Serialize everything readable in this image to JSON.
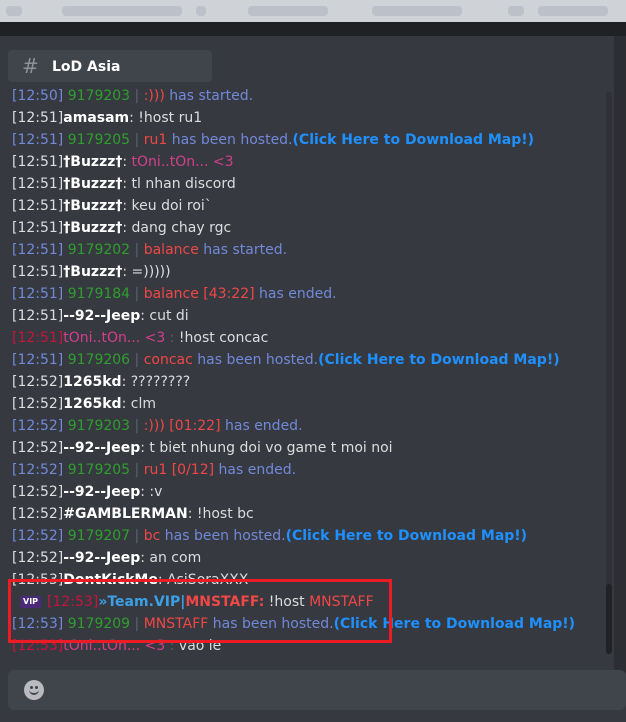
{
  "channel": {
    "name": "LoD Asia"
  },
  "messages": [
    {
      "parts": [
        {
          "text": "[12:50] ",
          "cls": "tp"
        },
        {
          "text": "9179203",
          "cls": "g"
        },
        {
          "text": " | ",
          "cls": "s"
        },
        {
          "text": ":))) ",
          "cls": "r"
        },
        {
          "text": "has started.",
          "cls": "b"
        }
      ]
    },
    {
      "parts": [
        {
          "text": "[12:51]",
          "cls": "t"
        },
        {
          "text": "amasam",
          "cls": "n"
        },
        {
          "text": ": !host ru1",
          "cls": "m"
        }
      ]
    },
    {
      "parts": [
        {
          "text": "[12:51] ",
          "cls": "tp"
        },
        {
          "text": "9179205",
          "cls": "g"
        },
        {
          "text": " | ",
          "cls": "s"
        },
        {
          "text": "ru1 ",
          "cls": "r"
        },
        {
          "text": "has been hosted.",
          "cls": "b"
        },
        {
          "text": "(Click Here to Download Map!)",
          "cls": "c"
        }
      ]
    },
    {
      "parts": [
        {
          "text": "[12:51]",
          "cls": "t"
        },
        {
          "text": "†Buzzz†",
          "cls": "n"
        },
        {
          "text": ": ",
          "cls": "m"
        },
        {
          "text": "tOni..tOn... <3",
          "cls": "pk"
        }
      ]
    },
    {
      "parts": [
        {
          "text": "[12:51]",
          "cls": "t"
        },
        {
          "text": "†Buzzz†",
          "cls": "n"
        },
        {
          "text": ": tl nhan discord",
          "cls": "m"
        }
      ]
    },
    {
      "parts": [
        {
          "text": "[12:51]",
          "cls": "t"
        },
        {
          "text": "†Buzzz†",
          "cls": "n"
        },
        {
          "text": ": keu doi roi`",
          "cls": "m"
        }
      ]
    },
    {
      "parts": [
        {
          "text": "[12:51]",
          "cls": "t"
        },
        {
          "text": "†Buzzz†",
          "cls": "n"
        },
        {
          "text": ": dang chay rgc",
          "cls": "m"
        }
      ]
    },
    {
      "parts": [
        {
          "text": "[12:51] ",
          "cls": "tp"
        },
        {
          "text": "9179202",
          "cls": "g"
        },
        {
          "text": " | ",
          "cls": "s"
        },
        {
          "text": "balance ",
          "cls": "r"
        },
        {
          "text": "has started.",
          "cls": "b"
        }
      ]
    },
    {
      "parts": [
        {
          "text": "[12:51]",
          "cls": "t"
        },
        {
          "text": "†Buzzz†",
          "cls": "n"
        },
        {
          "text": ": =)))))",
          "cls": "m"
        }
      ]
    },
    {
      "parts": [
        {
          "text": "[12:51] ",
          "cls": "tp"
        },
        {
          "text": "9179184",
          "cls": "g"
        },
        {
          "text": " | ",
          "cls": "s"
        },
        {
          "text": "balance [43:22] ",
          "cls": "r"
        },
        {
          "text": "has ended.",
          "cls": "b"
        }
      ]
    },
    {
      "parts": [
        {
          "text": "[12:51]",
          "cls": "t"
        },
        {
          "text": "--92--Jeep",
          "cls": "n"
        },
        {
          "text": ": cut di",
          "cls": "m"
        }
      ]
    },
    {
      "parts": [
        {
          "text": "[12:51]",
          "cls": "tr"
        },
        {
          "text": "tOni..tOn... <3",
          "cls": "pk"
        },
        {
          "text": " : ",
          "cls": "s"
        },
        {
          "text": "!host concac",
          "cls": "m"
        }
      ]
    },
    {
      "parts": [
        {
          "text": "[12:51] ",
          "cls": "tp"
        },
        {
          "text": "9179206",
          "cls": "g"
        },
        {
          "text": " | ",
          "cls": "s"
        },
        {
          "text": "concac ",
          "cls": "r"
        },
        {
          "text": "has been hosted.",
          "cls": "b"
        },
        {
          "text": "(Click Here to Download Map!)",
          "cls": "c"
        }
      ]
    },
    {
      "parts": [
        {
          "text": "[12:52]",
          "cls": "t"
        },
        {
          "text": "1265kd",
          "cls": "n"
        },
        {
          "text": ": ????????",
          "cls": "m"
        }
      ]
    },
    {
      "parts": [
        {
          "text": "[12:52]",
          "cls": "t"
        },
        {
          "text": "1265kd",
          "cls": "n"
        },
        {
          "text": ": clm",
          "cls": "m"
        }
      ]
    },
    {
      "parts": [
        {
          "text": "[12:52] ",
          "cls": "tp"
        },
        {
          "text": "9179203",
          "cls": "g"
        },
        {
          "text": " | ",
          "cls": "s"
        },
        {
          "text": ":))) [01:22] ",
          "cls": "r"
        },
        {
          "text": "has ended.",
          "cls": "b"
        }
      ]
    },
    {
      "parts": [
        {
          "text": "[12:52]",
          "cls": "t"
        },
        {
          "text": "--92--Jeep",
          "cls": "n"
        },
        {
          "text": ": t biet nhung doi vo game t moi noi",
          "cls": "m"
        }
      ]
    },
    {
      "parts": [
        {
          "text": "[12:52] ",
          "cls": "tp"
        },
        {
          "text": "9179205",
          "cls": "g"
        },
        {
          "text": " | ",
          "cls": "s"
        },
        {
          "text": "ru1 [0/12] ",
          "cls": "r"
        },
        {
          "text": "has ended.",
          "cls": "b"
        }
      ]
    },
    {
      "parts": [
        {
          "text": "[12:52]",
          "cls": "t"
        },
        {
          "text": "--92--Jeep",
          "cls": "n"
        },
        {
          "text": ": :v",
          "cls": "m"
        }
      ]
    },
    {
      "parts": [
        {
          "text": "[12:52]",
          "cls": "t"
        },
        {
          "text": "#GAMBLERMAN",
          "cls": "n"
        },
        {
          "text": ": !host bc",
          "cls": "m"
        }
      ]
    },
    {
      "parts": [
        {
          "text": "[12:52] ",
          "cls": "tp"
        },
        {
          "text": "9179207",
          "cls": "g"
        },
        {
          "text": " | ",
          "cls": "s"
        },
        {
          "text": "bc ",
          "cls": "r"
        },
        {
          "text": "has been hosted.",
          "cls": "b"
        },
        {
          "text": "(Click Here to Download Map!)",
          "cls": "c"
        }
      ]
    },
    {
      "parts": [
        {
          "text": "[12:52]",
          "cls": "t"
        },
        {
          "text": "--92--Jeep",
          "cls": "n"
        },
        {
          "text": ": an com",
          "cls": "m"
        }
      ]
    },
    {
      "parts": [
        {
          "text": "[12:53]",
          "cls": "t"
        },
        {
          "text": "DontKickMe",
          "cls": "n"
        },
        {
          "text": ": AsiSoraXXX",
          "cls": "m"
        }
      ]
    },
    {
      "parts": [
        {
          "text": "VIP",
          "cls": "vip"
        },
        {
          "text": "[12:53]",
          "cls": "tr"
        },
        {
          "text": "»Team.VIP|",
          "cls": "tv"
        },
        {
          "text": "MNSTAFF:",
          "cls": "mns"
        },
        {
          "text": " !host ",
          "cls": "m"
        },
        {
          "text": "MNSTAFF",
          "cls": "r"
        }
      ]
    },
    {
      "parts": [
        {
          "text": "[12:53] ",
          "cls": "tp"
        },
        {
          "text": "9179209",
          "cls": "g"
        },
        {
          "text": " | ",
          "cls": "s"
        },
        {
          "text": "MNSTAFF ",
          "cls": "r"
        },
        {
          "text": "has been hosted.",
          "cls": "b"
        },
        {
          "text": "(Click Here to Download Map!)",
          "cls": "c"
        }
      ]
    },
    {
      "parts": [
        {
          "text": "[12:53]",
          "cls": "tr"
        },
        {
          "text": "tOni..tOn... <3",
          "cls": "pk"
        },
        {
          "text": " : ",
          "cls": "s"
        },
        {
          "text": "vao le",
          "cls": "m"
        }
      ]
    }
  ],
  "colors": {
    "background": "#36393f",
    "highlight_border": "#ed1c24",
    "link": "#1e90ff",
    "bot_text": "#7289da",
    "game_id": "#2e9f2e",
    "game_name": "#f04747"
  },
  "icons": {
    "channel": "hash-icon",
    "emoji": "emoji-icon"
  }
}
